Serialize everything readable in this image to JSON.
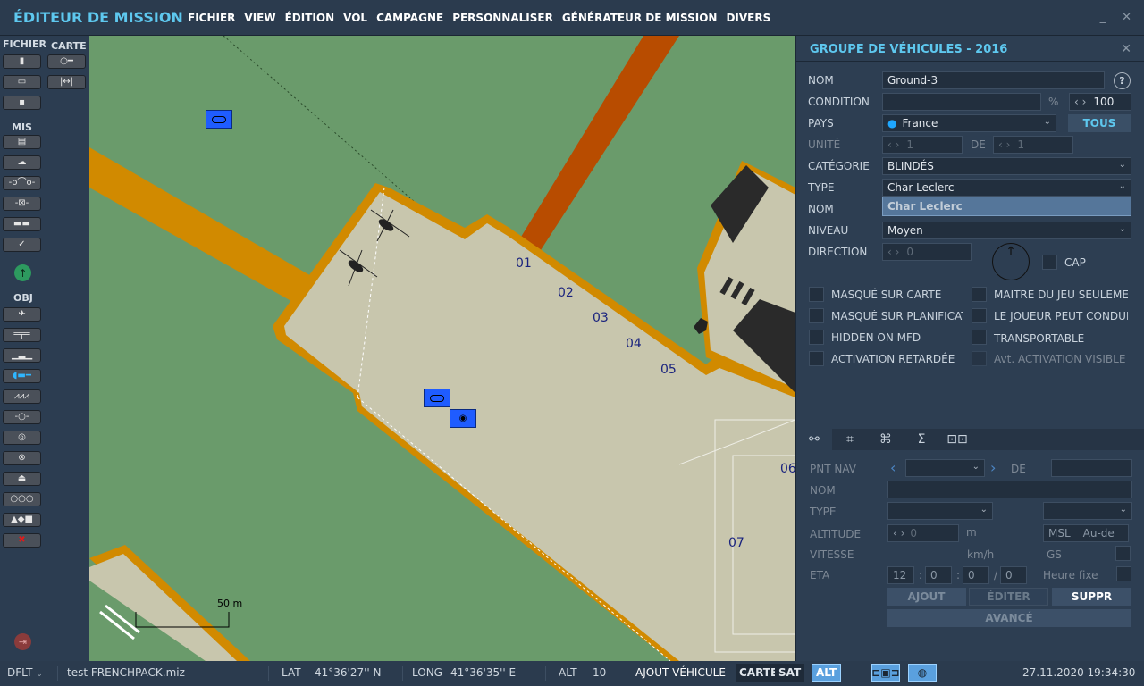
{
  "app": {
    "title": "ÉDITEUR DE MISSION",
    "menu": [
      "FICHIER",
      "VIEW",
      "ÉDITION",
      "VOL",
      "CAMPAGNE",
      "PERSONNALISER",
      "GÉNÉRATEUR DE MISSION",
      "DIVERS"
    ],
    "minimize": "_",
    "close": "✕"
  },
  "toolbar": {
    "fichier": "FICHIER",
    "carte": "CARTE",
    "mis": "MIS",
    "obj": "OBJ"
  },
  "map": {
    "markers": [
      "01",
      "02",
      "03",
      "04",
      "05",
      "06",
      "07"
    ],
    "scale": "50 m"
  },
  "panel": {
    "title": "GROUPE DE VÉHICULES - 2016",
    "nom_label": "NOM",
    "nom_value": "Ground-3",
    "help": "?",
    "condition_label": "CONDITION",
    "condition_value": "",
    "percent": "%",
    "condition_spin": "100",
    "pays_label": "PAYS",
    "pays_value": "France",
    "tous": "TOUS",
    "unite_label": "UNITÉ",
    "unite_value": "1",
    "de_label": "DE",
    "de_value": "1",
    "categorie_label": "CATÉGORIE",
    "categorie_value": "BLINDÉS",
    "type_label": "TYPE",
    "type_value": "Char Leclerc",
    "type_option": "Char Leclerc",
    "nom2_label": "NOM",
    "niveau_label": "NIVEAU",
    "niveau_value": "Moyen",
    "direction_label": "DIRECTION",
    "direction_value": "0",
    "cap_label": "CAP",
    "checkboxes_left": [
      "MASQUÉ SUR CARTE",
      "MASQUÉ SUR PLANIFICAT",
      "HIDDEN ON MFD",
      "ACTIVATION RETARDÉE"
    ],
    "checkboxes_right": [
      "MAÎTRE DU JEU SEULEMEN",
      "LE JOUEUR PEUT CONDUI",
      "TRANSPORTABLE",
      "Avt. ACTIVATION VISIBLE"
    ]
  },
  "waypoints": {
    "pntnav_label": "PNT NAV",
    "de_label": "DE",
    "nom_label": "NOM",
    "type_label": "TYPE",
    "altitude_label": "ALTITUDE",
    "altitude_value": "0",
    "altitude_unit": "m",
    "alt_ref": "MSL",
    "alt_mode": "Au-de",
    "vitesse_label": "VITESSE",
    "vitesse_unit": "km/h",
    "gs_label": "GS",
    "eta_label": "ETA",
    "eta": [
      "12",
      "0",
      "0",
      "0"
    ],
    "heure_fixe": "Heure fixe",
    "ajout": "AJOUT",
    "editer": "ÉDITER",
    "suppr": "SUPPR",
    "avance": "AVANCÉ"
  },
  "status": {
    "profile": "DFLT",
    "file": "test FRENCHPACK.miz",
    "lat_label": "LAT",
    "lat": "41°36'27'' N",
    "long_label": "LONG",
    "long": "41°36'35'' E",
    "alt_label": "ALT",
    "alt": "10",
    "action": "AJOUT VÉHICULE",
    "carte": "CARTE",
    "sat": "SAT",
    "alt_btn": "ALT",
    "datetime": "27.11.2020 19:34:30"
  },
  "colors": {
    "accent": "#5ec8ef",
    "map_green": "#6a9b6b",
    "apron": "#c8c6ad",
    "taxi": "#d18a00",
    "unit_blue": "#1f5cff"
  }
}
